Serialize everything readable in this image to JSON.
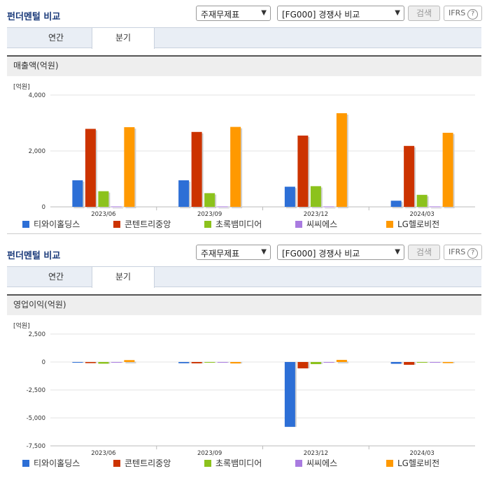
{
  "panels": [
    {
      "title": "펀더멘털 비교",
      "select1": "주재무제표",
      "select2": "[FG000] 경쟁사 비교",
      "search_label": "검색",
      "ifrs_label": "IFRS",
      "help_glyph": "?",
      "tabs": [
        "연간",
        "분기"
      ],
      "active_tab": "분기",
      "section_title": "매출액(억원)"
    },
    {
      "title": "펀더멘털 비교",
      "select1": "주재무제표",
      "select2": "[FG000] 경쟁사 비교",
      "search_label": "검색",
      "ifrs_label": "IFRS",
      "help_glyph": "?",
      "tabs": [
        "연간",
        "분기"
      ],
      "active_tab": "분기",
      "section_title": "영업이익(억원)"
    }
  ],
  "colors": [
    "#2d6fd6",
    "#cc3300",
    "#8cc21c",
    "#a97be0",
    "#ff9900"
  ],
  "chart_data": [
    {
      "type": "bar",
      "unit_label": "[억원]",
      "categories": [
        "2023/06",
        "2023/09",
        "2023/12",
        "2024/03"
      ],
      "ylim": [
        0,
        4000
      ],
      "yticks": [
        0,
        2000,
        4000
      ],
      "ytick_labels": [
        "0",
        "2,000",
        "4,000"
      ],
      "grid": true,
      "legend_position": "bottom",
      "series": [
        {
          "name": "티와이홀딩스",
          "values": [
            950,
            950,
            720,
            220
          ]
        },
        {
          "name": "콘텐트리중앙",
          "values": [
            2790,
            2680,
            2550,
            2180
          ]
        },
        {
          "name": "초록뱀미디어",
          "values": [
            560,
            490,
            740,
            430
          ]
        },
        {
          "name": "씨씨에스",
          "values": [
            15,
            15,
            15,
            15
          ]
        },
        {
          "name": "LG헬로비전",
          "values": [
            2850,
            2860,
            3350,
            2650
          ]
        }
      ]
    },
    {
      "type": "bar",
      "unit_label": "[억원]",
      "categories": [
        "2023/06",
        "2023/09",
        "2023/12",
        "2024/03"
      ],
      "ylim": [
        -7500,
        2500
      ],
      "yticks": [
        2500,
        0,
        -2500,
        -5000,
        -7500
      ],
      "ytick_labels": [
        "2,500",
        "0",
        "-2,500",
        "-5,000",
        "-7,500"
      ],
      "grid": true,
      "legend_position": "bottom",
      "series": [
        {
          "name": "티와이홀딩스",
          "values": [
            -60,
            -110,
            -5800,
            -160
          ]
        },
        {
          "name": "콘텐트리중앙",
          "values": [
            -100,
            -120,
            -570,
            -250
          ]
        },
        {
          "name": "초록뱀미디어",
          "values": [
            -150,
            -30,
            -190,
            -20
          ]
        },
        {
          "name": "씨씨에스",
          "values": [
            -10,
            -10,
            -20,
            -10
          ]
        },
        {
          "name": "LG헬로비전",
          "values": [
            170,
            -130,
            190,
            -100
          ]
        }
      ]
    }
  ]
}
